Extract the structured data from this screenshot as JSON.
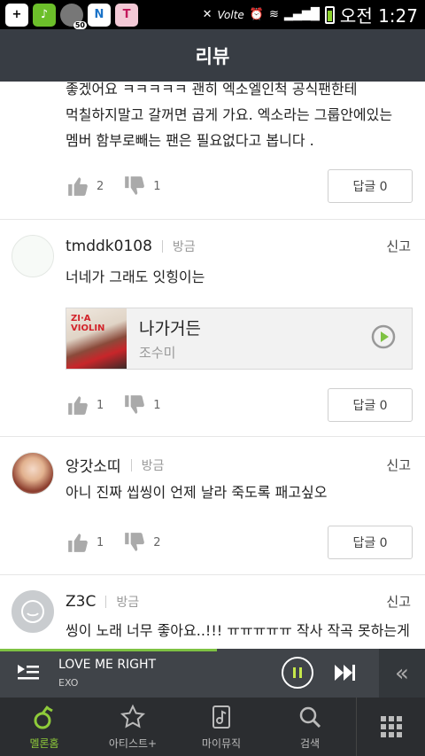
{
  "status_bar": {
    "time": "오전 1:27",
    "volte": "Volte",
    "notif_count": "50",
    "n_label": "N"
  },
  "header": {
    "title": "리뷰"
  },
  "reviews": [
    {
      "text": "좋겠어요 ㅋㅋㅋㅋㅋ 괜히 엑소엘인척 공식팬한테\n먹칠하지말고 갈꺼면 곱게 가요. 엑소라는 그룹안에있는\n멤버 함부로빼는 팬은 필요없다고 봅니다 .",
      "likes": "2",
      "dislikes": "1",
      "reply_label": "답글 0"
    },
    {
      "user": "tmddk0108",
      "time": "방금",
      "report": "신고",
      "text": "너네가 그래도 잇힝이는",
      "song": {
        "title": "나가거든",
        "artist": "조수미",
        "art_text": "ZI·A VIOLIN"
      },
      "likes": "1",
      "dislikes": "1",
      "reply_label": "답글 0"
    },
    {
      "user": "앙갓소띠",
      "time": "방금",
      "report": "신고",
      "text": "아니 진짜 씹씽이 언제 날라 죽도록 패고싶오",
      "likes": "1",
      "dislikes": "2",
      "reply_label": "답글 0"
    },
    {
      "user": "Z3C",
      "time": "방금",
      "report": "신고",
      "text": "씽이 노래 너무 좋아요..!!! ㅠㅠㅠㅠㅠ 작사 작곡 못하는게\n뭐야 ㅠㅠㅠㅠㅠ 내새끼"
    }
  ],
  "player": {
    "title": "LOVE ME RIGHT",
    "artist": "EXO",
    "progress": 0.51
  },
  "bottom_nav": [
    {
      "label": "멜론홈",
      "icon": "melon-home-icon",
      "active": true
    },
    {
      "label": "아티스트+",
      "icon": "star-icon",
      "active": false
    },
    {
      "label": "마이뮤직",
      "icon": "my-music-icon",
      "active": false
    },
    {
      "label": "검색",
      "icon": "search-icon",
      "active": false
    }
  ],
  "colors": {
    "header": "#383d44",
    "accent_green": "#7ec242",
    "player_bg": "#404449",
    "nav_bg": "#2b2d30"
  }
}
